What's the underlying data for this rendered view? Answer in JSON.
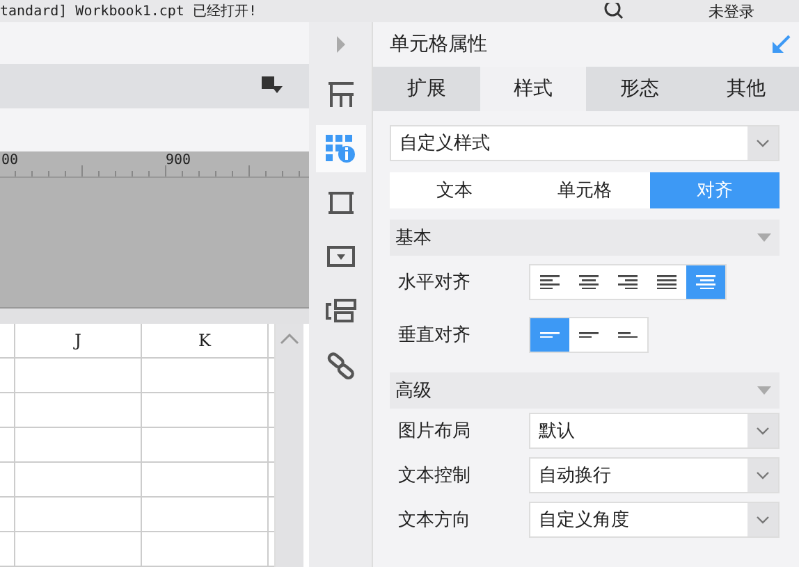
{
  "status_bar": {
    "message": "tandard]  Workbook1.cpt 已经打开!",
    "user": "未登录"
  },
  "ruler": {
    "labels": [
      "00",
      "900"
    ]
  },
  "sheet": {
    "columns": [
      "J",
      "K"
    ]
  },
  "side_icons": [
    {
      "kind": "expand",
      "selected": false
    },
    {
      "kind": "frame",
      "selected": false
    },
    {
      "kind": "attributes",
      "selected": true
    },
    {
      "kind": "border",
      "selected": false
    },
    {
      "kind": "widget",
      "selected": false
    },
    {
      "kind": "layers",
      "selected": false
    },
    {
      "kind": "link",
      "selected": false
    }
  ],
  "panel": {
    "title": "单元格属性",
    "tabs": [
      {
        "label": "扩展",
        "selected": false
      },
      {
        "label": "样式",
        "selected": true
      },
      {
        "label": "形态",
        "selected": false
      },
      {
        "label": "其他",
        "selected": false
      }
    ],
    "style_select": {
      "value": "自定义样式"
    },
    "subtabs": [
      {
        "label": "文本",
        "selected": false
      },
      {
        "label": "单元格",
        "selected": false
      },
      {
        "label": "对齐",
        "selected": true
      }
    ],
    "sections": [
      {
        "title": "基本",
        "rows": [
          {
            "label": "水平对齐",
            "kind": "buttons",
            "options": [
              {
                "kind": "left",
                "selected": false
              },
              {
                "kind": "center",
                "selected": false
              },
              {
                "kind": "right",
                "selected": false
              },
              {
                "kind": "justify",
                "selected": false
              },
              {
                "kind": "distributed",
                "selected": true
              }
            ]
          },
          {
            "label": "垂直对齐",
            "kind": "buttons",
            "options": [
              {
                "kind": "top",
                "selected": true
              },
              {
                "kind": "middle",
                "selected": false
              },
              {
                "kind": "bottom",
                "selected": false
              }
            ]
          }
        ]
      },
      {
        "title": "高级",
        "rows": [
          {
            "label": "图片布局",
            "kind": "select",
            "value": "默认"
          },
          {
            "label": "文本控制",
            "kind": "select",
            "value": "自动换行"
          },
          {
            "label": "文本方向",
            "kind": "select",
            "value": "自定义角度"
          }
        ]
      }
    ]
  }
}
